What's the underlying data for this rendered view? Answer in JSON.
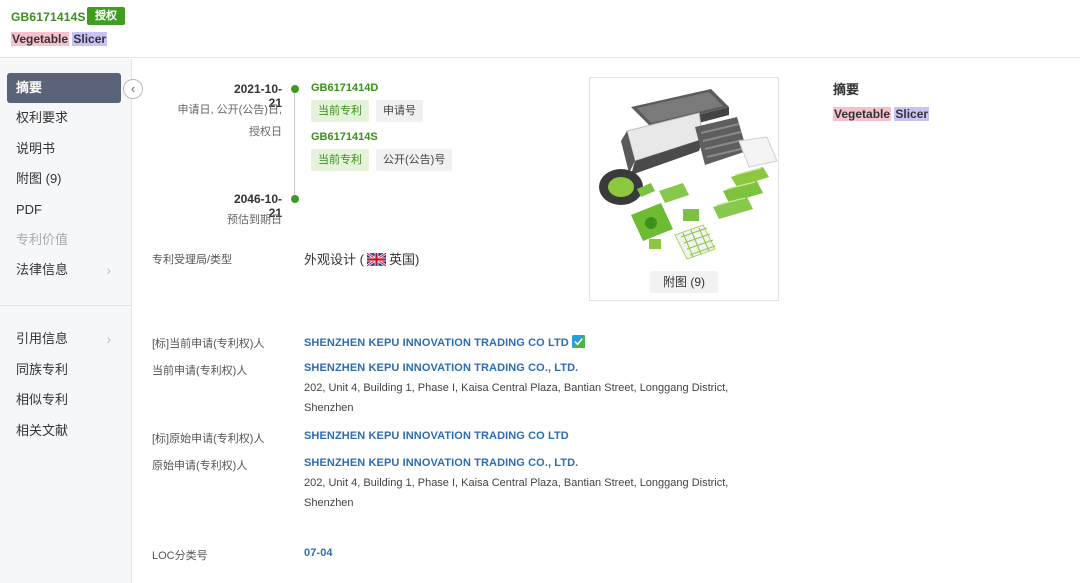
{
  "header": {
    "publication_number": "GB6171414S",
    "status_badge": "授权",
    "title_word1": "Vegetable",
    "title_word2": "Slicer"
  },
  "sidebar": {
    "items": [
      {
        "label": "摘要",
        "active": true
      },
      {
        "label": "权利要求"
      },
      {
        "label": "说明书"
      },
      {
        "label": "附图 (9)"
      },
      {
        "label": "PDF"
      },
      {
        "label": "专利价值",
        "disabled": true
      },
      {
        "label": "法律信息",
        "chevron": "›"
      },
      {
        "label": "引用信息",
        "chevron": "›"
      },
      {
        "label": "同族专利"
      },
      {
        "label": "相似专利"
      },
      {
        "label": "相关文献"
      }
    ],
    "collapse_glyph": "‹"
  },
  "timeline": {
    "start_date": "2021-10-21",
    "start_label_1": "申请日, 公开(公告)日,",
    "start_label_2": "授权日",
    "end_date": "2046-10-21",
    "end_label": "预估到期日",
    "app_number": "GB6171414D",
    "app_tag1": "当前专利",
    "app_tag2": "申请号",
    "pub_number": "GB6171414S",
    "pub_tag1": "当前专利",
    "pub_tag2": "公开(公告)号"
  },
  "office": {
    "label": "专利受理局/类型",
    "type": "外观设计 (",
    "country": "英国)",
    "flag_icon": "uk-flag-icon"
  },
  "image_panel": {
    "figure_button": "附图 (9)"
  },
  "abstract": {
    "heading": "摘要",
    "word1": "Vegetable",
    "word2": "Slicer"
  },
  "fields": {
    "std_current_label": "[标]当前申请(专利权)人",
    "std_current_value": "SHENZHEN KEPU INNOVATION TRADING CO LTD",
    "current_label": "当前申请(专利权)人",
    "current_value": "SHENZHEN KEPU INNOVATION TRADING CO., LTD.",
    "current_addr_1": "202, Unit 4, Building 1, Phase I, Kaisa Central Plaza, Bantian Street, Longgang District,",
    "current_addr_2": "Shenzhen",
    "std_original_label": "[标]原始申请(专利权)人",
    "std_original_value": "SHENZHEN KEPU INNOVATION TRADING CO LTD",
    "original_label": "原始申请(专利权)人",
    "original_value": "SHENZHEN KEPU INNOVATION TRADING CO., LTD.",
    "original_addr_1": "202, Unit 4, Building 1, Phase I, Kaisa Central Plaza, Bantian Street, Longgang District,",
    "original_addr_2": "Shenzhen",
    "loc_label": "LOC分类号",
    "loc_value": "07-04"
  },
  "colors": {
    "brand_green": "#3f9e22",
    "link_blue": "#2e6cb3",
    "sidebar_active": "#5b6378"
  }
}
